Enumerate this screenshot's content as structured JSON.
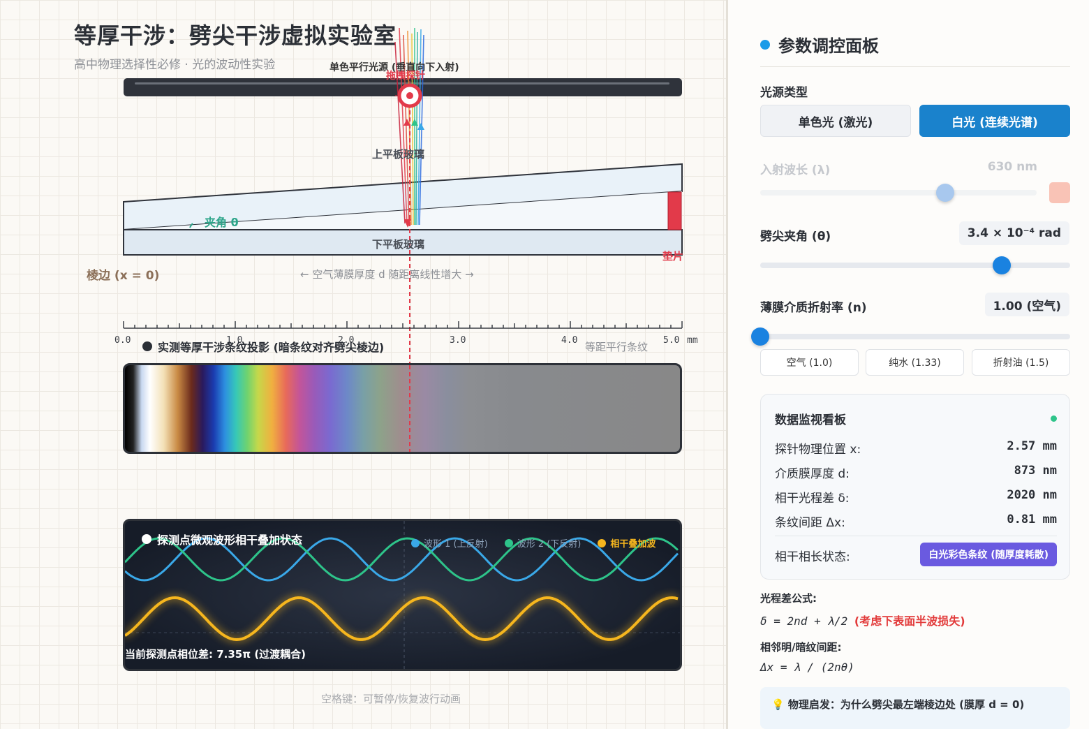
{
  "header": {
    "title": "等厚干涉：劈尖干涉虚拟实验室",
    "subtitle": "高中物理选择性必修 · 光的波动性实验"
  },
  "apparatus": {
    "source_label": "单色平行光源 (垂直向下入射)",
    "drag_label": "拖拽探针",
    "upper_plate_label": "上平板玻璃",
    "angle_label": "夹角 θ",
    "lower_plate_label": "下平板玻璃",
    "shim_label": "垫片",
    "edge_label": "棱边 (x = 0)",
    "film_label": "← 空气薄膜厚度 d 随距离线性增大 →"
  },
  "ruler": {
    "ticks": [
      "0.0",
      "1.0",
      "2.0",
      "3.0",
      "4.0",
      "5.0"
    ],
    "unit": "mm"
  },
  "pattern": {
    "title": "实测等厚干涉条纹投影 (暗条纹对齐劈尖棱边)",
    "note": "等距平行条纹"
  },
  "waveform": {
    "title": "探测点微观波形相干叠加状态",
    "legend": [
      {
        "label": "波形 1 (上反射)",
        "color": "#3aa8e8"
      },
      {
        "label": "波形 2 (下反射)",
        "color": "#2ec48a"
      },
      {
        "label": "相干叠加波",
        "color": "#f6b61e"
      }
    ],
    "phase_text": "当前探测点相位差: 7.35π (过渡耦合)"
  },
  "hint": "空格键：可暂停/恢复波行动画",
  "panel": {
    "title": "参数调控面板",
    "source_type_label": "光源类型",
    "source_buttons": [
      "单色光 (激光)",
      "白光 (连续光谱)"
    ],
    "wavelength_label": "入射波长 (λ)",
    "wavelength_value": "630 nm",
    "wavelength_swatch": "#f9c3b6",
    "wavelength_slider_fraction": 0.67,
    "angle_label": "劈尖夹角 (θ)",
    "angle_value": "3.4 × 10⁻⁴ rad",
    "angle_slider_fraction": 0.78,
    "index_label": "薄膜介质折射率 (n)",
    "index_value": "1.00 (空气)",
    "index_slider_fraction": 0.0,
    "media_buttons": [
      "空气 (1.0)",
      "纯水 (1.33)",
      "折射油 (1.5)"
    ]
  },
  "monitor": {
    "title": "数据监视看板",
    "rows": [
      {
        "label": "探针物理位置 x:",
        "value": "2.57 mm"
      },
      {
        "label": "介质膜厚度 d:",
        "value": "873 nm"
      },
      {
        "label": "相干光程差 δ:",
        "value": "2020 nm"
      },
      {
        "label": "条纹间距 Δx:",
        "value": "0.81 mm"
      }
    ],
    "state_label": "相干相长状态:",
    "state_value": "白光彩色条纹 (随厚度耗散)"
  },
  "formulas": {
    "path_label": "光程差公式:",
    "path_formula": "δ = 2nd + λ/2",
    "path_note": "(考虑下表面半波损失)",
    "spacing_label": "相邻明/暗纹间距:",
    "spacing_formula": "Δx = λ / (2nθ)"
  },
  "insight": "💡 物理启发：为什么劈尖最左端棱边处 (膜厚 d = 0)"
}
